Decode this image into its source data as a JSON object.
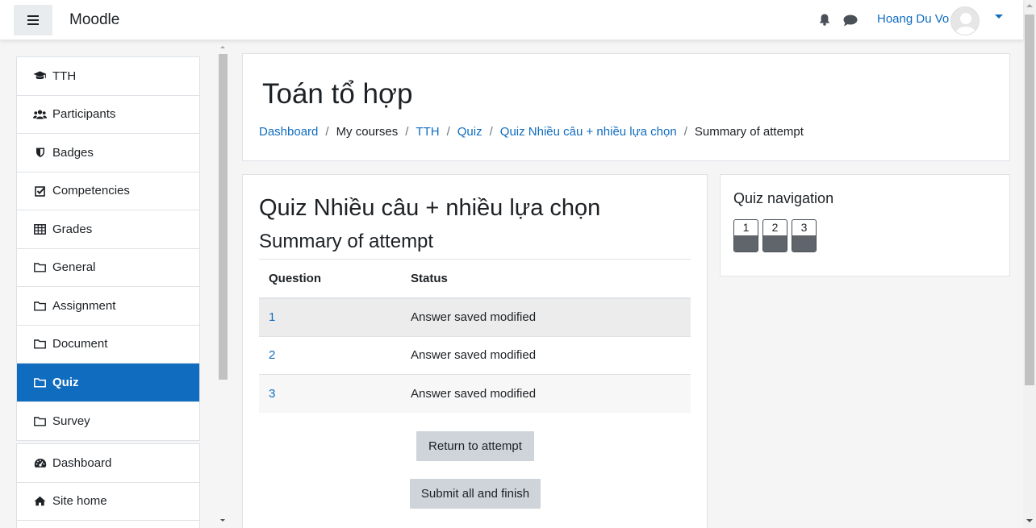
{
  "navbar": {
    "brand": "Moodle",
    "user_name": "Hoang Du Vo"
  },
  "drawer": {
    "course_items": [
      {
        "label": "TTH",
        "icon": "graduation-cap-icon"
      },
      {
        "label": "Participants",
        "icon": "users-icon"
      },
      {
        "label": "Badges",
        "icon": "shield-icon"
      },
      {
        "label": "Competencies",
        "icon": "check-square-icon"
      },
      {
        "label": "Grades",
        "icon": "table-icon"
      },
      {
        "label": "General",
        "icon": "folder-icon"
      },
      {
        "label": "Assignment",
        "icon": "folder-icon"
      },
      {
        "label": "Document",
        "icon": "folder-icon"
      },
      {
        "label": "Quiz",
        "icon": "folder-icon",
        "active": true
      },
      {
        "label": "Survey",
        "icon": "folder-icon"
      }
    ],
    "site_items": [
      {
        "label": "Dashboard",
        "icon": "tachometer-icon"
      },
      {
        "label": "Site home",
        "icon": "home-icon"
      }
    ]
  },
  "header": {
    "course_title": "Toán tổ hợp",
    "breadcrumb": [
      "Dashboard",
      "My courses",
      "TTH",
      "Quiz",
      "Quiz Nhiều câu + nhiều lựa chọn",
      "Summary of attempt"
    ]
  },
  "main": {
    "quiz_title": "Quiz Nhiều câu + nhiều lựa chọn",
    "summary_title": "Summary of attempt",
    "table": {
      "headers": [
        "Question",
        "Status"
      ],
      "rows": [
        {
          "question": "1",
          "status": "Answer saved modified"
        },
        {
          "question": "2",
          "status": "Answer saved modified"
        },
        {
          "question": "3",
          "status": "Answer saved modified"
        }
      ]
    },
    "return_button": "Return to attempt",
    "submit_button": "Submit all and finish"
  },
  "quiz_nav": {
    "title": "Quiz navigation",
    "questions": [
      "1",
      "2",
      "3"
    ]
  },
  "colors": {
    "primary": "#0f6cbf",
    "button_gray": "#ced4da",
    "answered_fill": "#5f656b"
  }
}
